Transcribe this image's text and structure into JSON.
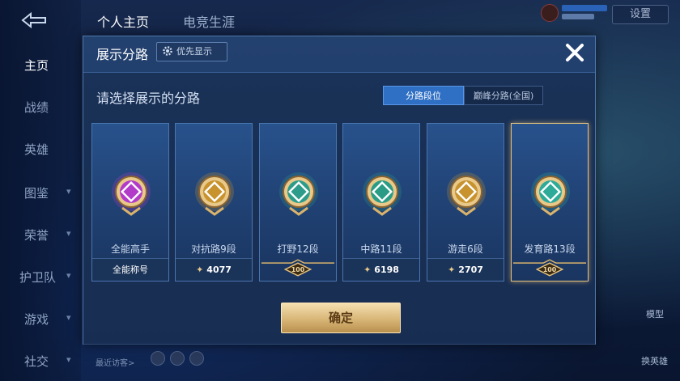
{
  "top_tabs": [
    "个人主页",
    "电竞生涯"
  ],
  "settings_label": "设置",
  "sidebar": [
    {
      "label": "主页",
      "chevron": false
    },
    {
      "label": "战绩",
      "chevron": false
    },
    {
      "label": "英雄",
      "chevron": false
    },
    {
      "label": "图鉴",
      "chevron": true
    },
    {
      "label": "荣誉",
      "chevron": true
    },
    {
      "label": "护卫队",
      "chevron": true
    },
    {
      "label": "游戏",
      "chevron": true
    },
    {
      "label": "社交",
      "chevron": true
    }
  ],
  "recent_visitors_label": "最近访客>",
  "right_buttons": {
    "model": "模型",
    "switch_hero": "换英雄"
  },
  "modal": {
    "title": "展示分路",
    "pref_button": "优先显示",
    "prompt": "请选择展示的分路",
    "segments": [
      "分路段位",
      "巅峰分路(全国)"
    ],
    "active_segment": 0,
    "confirm": "确定"
  },
  "cards": [
    {
      "name": "全能高手",
      "footer": "全能称号",
      "points": null,
      "tier": null,
      "color": "#b23cc9"
    },
    {
      "name": "对抗路9段",
      "footer": null,
      "points": "4077",
      "tier": null,
      "color": "#c8922e"
    },
    {
      "name": "打野12段",
      "footer": null,
      "points": null,
      "tier": "100",
      "color": "#2e9c8a"
    },
    {
      "name": "中路11段",
      "footer": null,
      "points": "6198",
      "tier": null,
      "color": "#2a9c86"
    },
    {
      "name": "游走6段",
      "footer": null,
      "points": "2707",
      "tier": null,
      "color": "#c8922e"
    },
    {
      "name": "发育路13段",
      "footer": null,
      "points": null,
      "tier": "100",
      "color": "#2eaa98"
    }
  ],
  "selected_card": 5,
  "colors": {
    "accent_blue": "#2f6fc4",
    "gold": "#e5c27e"
  }
}
